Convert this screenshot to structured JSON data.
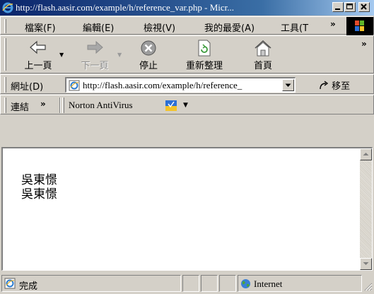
{
  "window": {
    "title": "http://flash.aasir.com/example/h/reference_var.php - Micr..."
  },
  "menu": {
    "items": [
      "檔案(F)",
      "編輯(E)",
      "檢視(V)",
      "我的最愛(A)",
      "工具(T"
    ],
    "overflow": "»"
  },
  "toolbar": {
    "back": "上一頁",
    "forward": "下一頁",
    "stop": "停止",
    "refresh": "重新整理",
    "home": "首頁",
    "overflow": "»"
  },
  "address": {
    "label": "網址(D)",
    "url": "http://flash.aasir.com/example/h/reference_",
    "go": "移至"
  },
  "links": {
    "label": "連結",
    "overflow": "»",
    "norton": "Norton AntiVirus"
  },
  "content": {
    "lines": [
      "吳東憬",
      "吳東憬"
    ]
  },
  "status": {
    "text": "完成",
    "zone": "Internet"
  },
  "colors": {
    "titlebar_start": "#0a246a",
    "titlebar_end": "#a6caf0",
    "chrome": "#d4d0c8"
  }
}
